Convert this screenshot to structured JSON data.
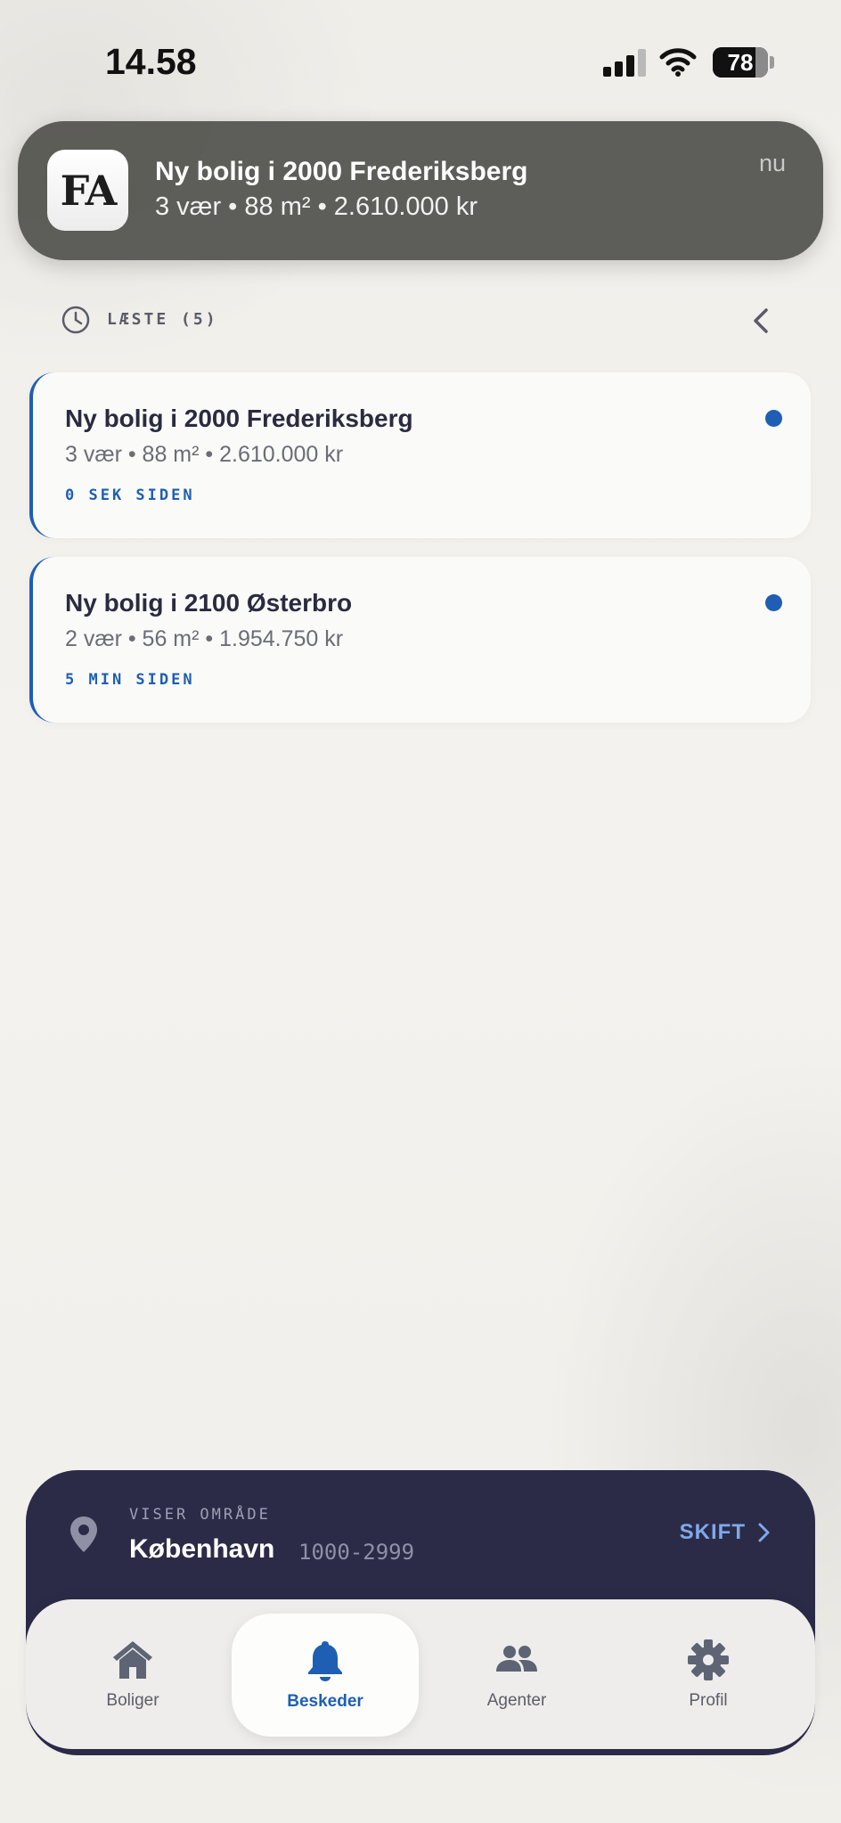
{
  "status_bar": {
    "time": "14.58",
    "battery_percent": "78",
    "battery_level": 0.78
  },
  "notification": {
    "app_icon_text": "FA",
    "title": "Ny bolig i 2000 Frederiksberg",
    "body": "3 vær • 88 m² • 2.610.000 kr",
    "time": "nu"
  },
  "read_section": {
    "label": "LÆSTE (5)"
  },
  "messages": [
    {
      "title": "Ny bolig i 2000 Frederiksberg",
      "details": "3 vær • 88 m² • 2.610.000 kr",
      "time_ago": "0 SEK SIDEN",
      "unread": true
    },
    {
      "title": "Ny bolig i 2100 Østerbro",
      "details": "2 vær • 56 m² • 1.954.750 kr",
      "time_ago": "5 MIN SIDEN",
      "unread": true
    }
  ],
  "area": {
    "label": "VISER OMRÅDE",
    "name": "København",
    "range": "1000-2999",
    "switch_label": "SKIFT"
  },
  "tabs": [
    {
      "label": "Boliger",
      "icon": "home-icon",
      "active": false
    },
    {
      "label": "Beskeder",
      "icon": "bell-icon",
      "active": true
    },
    {
      "label": "Agenter",
      "icon": "people-icon",
      "active": false
    },
    {
      "label": "Profil",
      "icon": "gear-icon",
      "active": false
    }
  ],
  "colors": {
    "accent": "#1e5fb4",
    "panel": "#2b2b48",
    "background": "#f3f1ec",
    "switch": "#7fa9ea"
  }
}
